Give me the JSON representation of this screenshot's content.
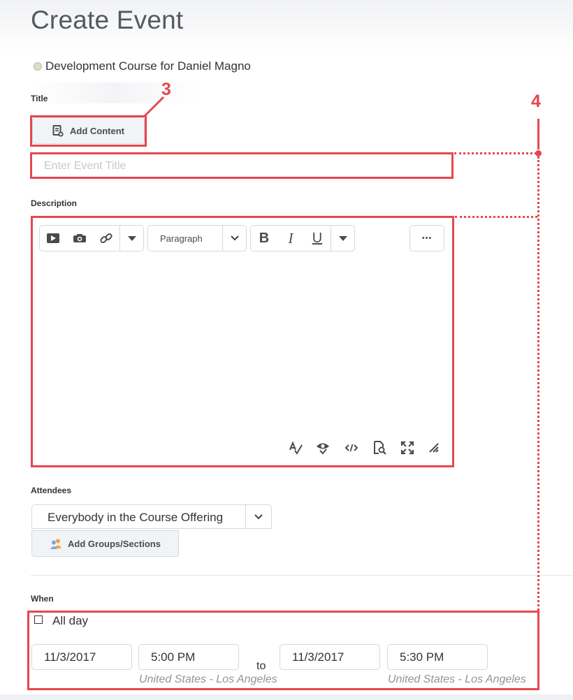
{
  "header": {
    "title": "Create Event",
    "course": "Development Course for Daniel Magno"
  },
  "title_section": {
    "label": "Title",
    "add_content_label": "Add Content",
    "input_value": "",
    "input_placeholder": "Enter Event Title"
  },
  "description": {
    "label": "Description",
    "format_select": "Paragraph",
    "bold": "B",
    "italic": "I",
    "underline": "U",
    "more": "•••"
  },
  "attendees": {
    "label": "Attendees",
    "selected": "Everybody in the Course Offering",
    "add_groups_label": "Add Groups/Sections"
  },
  "when": {
    "label": "When",
    "all_day_label": "All day",
    "all_day_checked": false,
    "start_date": "11/3/2017",
    "start_time": "5:00 PM",
    "to_label": "to",
    "end_date": "11/3/2017",
    "end_time": "5:30 PM",
    "start_timezone": "United States - Los Angeles",
    "end_timezone": "United States - Los Angeles"
  },
  "annotations": {
    "callout_3": "3",
    "callout_4": "4"
  },
  "colors": {
    "highlight": "#e5474f",
    "button_bg": "#f1f3f5",
    "border": "#d3d9e3"
  }
}
